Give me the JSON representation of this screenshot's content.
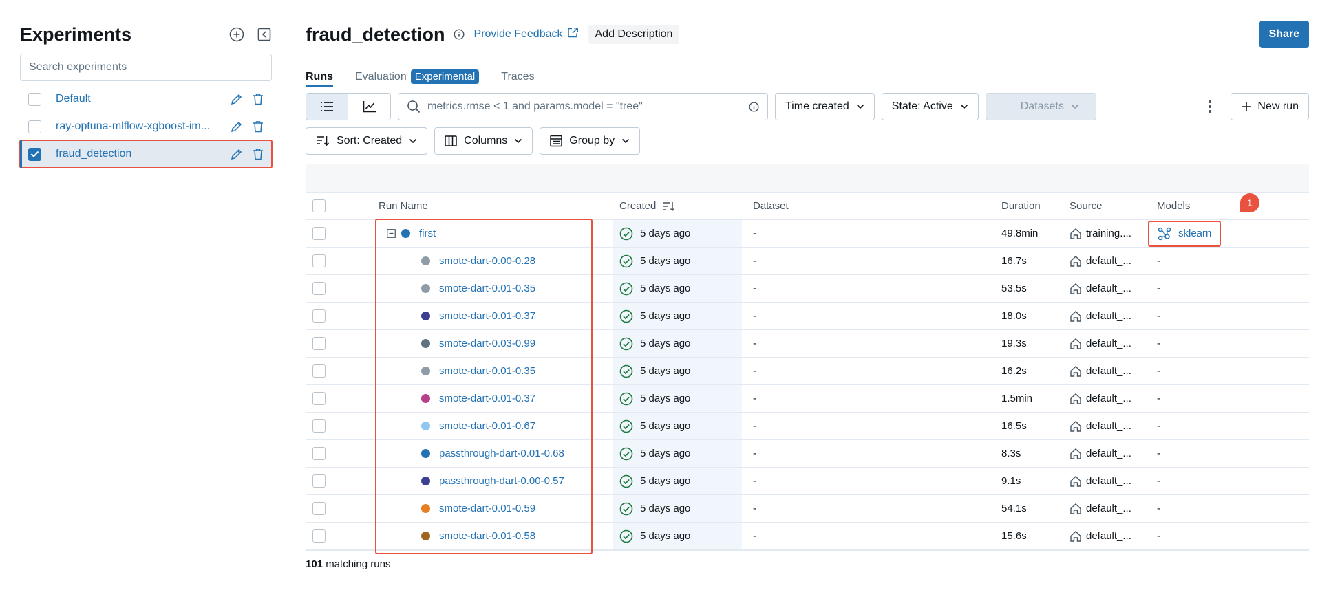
{
  "sidebar": {
    "title": "Experiments",
    "search_placeholder": "Search experiments",
    "items": [
      {
        "name": "Default",
        "checked": false
      },
      {
        "name": "ray-optuna-mlflow-xgboost-im...",
        "checked": false
      },
      {
        "name": "fraud_detection",
        "checked": true
      }
    ]
  },
  "header": {
    "title": "fraud_detection",
    "feedback_label": "Provide Feedback",
    "add_description_label": "Add Description",
    "share_label": "Share"
  },
  "tabs": {
    "runs": "Runs",
    "evaluation": "Evaluation",
    "evaluation_badge": "Experimental",
    "traces": "Traces"
  },
  "toolbar": {
    "search_value": "metrics.rmse < 1 and params.model = \"tree\"",
    "time_created": "Time created",
    "state": "State: Active",
    "datasets": "Datasets",
    "new_run": "New run",
    "sort": "Sort: Created",
    "columns": "Columns",
    "group_by": "Group by"
  },
  "table": {
    "headers": {
      "run_name": "Run Name",
      "created": "Created",
      "dataset": "Dataset",
      "duration": "Duration",
      "source": "Source",
      "models": "Models"
    },
    "rows": [
      {
        "name": "first",
        "color": "#2272b4",
        "created": "5 days ago",
        "dataset": "-",
        "duration": "49.8min",
        "source": "training....",
        "model": "sklearn",
        "parent": true
      },
      {
        "name": "smote-dart-0.00-0.28",
        "color": "#8f9ca8",
        "created": "5 days ago",
        "dataset": "-",
        "duration": "16.7s",
        "source": "default_...",
        "model": "-"
      },
      {
        "name": "smote-dart-0.01-0.35",
        "color": "#8f9ca8",
        "created": "5 days ago",
        "dataset": "-",
        "duration": "53.5s",
        "source": "default_...",
        "model": "-"
      },
      {
        "name": "smote-dart-0.01-0.37",
        "color": "#3c3f8f",
        "created": "5 days ago",
        "dataset": "-",
        "duration": "18.0s",
        "source": "default_...",
        "model": "-"
      },
      {
        "name": "smote-dart-0.03-0.99",
        "color": "#5f7281",
        "created": "5 days ago",
        "dataset": "-",
        "duration": "19.3s",
        "source": "default_...",
        "model": "-"
      },
      {
        "name": "smote-dart-0.01-0.35",
        "color": "#8f9ca8",
        "created": "5 days ago",
        "dataset": "-",
        "duration": "16.2s",
        "source": "default_...",
        "model": "-"
      },
      {
        "name": "smote-dart-0.01-0.37",
        "color": "#b83f8c",
        "created": "5 days ago",
        "dataset": "-",
        "duration": "1.5min",
        "source": "default_...",
        "model": "-"
      },
      {
        "name": "smote-dart-0.01-0.67",
        "color": "#8fc7f0",
        "created": "5 days ago",
        "dataset": "-",
        "duration": "16.5s",
        "source": "default_...",
        "model": "-"
      },
      {
        "name": "passthrough-dart-0.01-0.68",
        "color": "#2272b4",
        "created": "5 days ago",
        "dataset": "-",
        "duration": "8.3s",
        "source": "default_...",
        "model": "-"
      },
      {
        "name": "passthrough-dart-0.00-0.57",
        "color": "#3c3f8f",
        "created": "5 days ago",
        "dataset": "-",
        "duration": "9.1s",
        "source": "default_...",
        "model": "-"
      },
      {
        "name": "smote-dart-0.01-0.59",
        "color": "#e67e22",
        "created": "5 days ago",
        "dataset": "-",
        "duration": "54.1s",
        "source": "default_...",
        "model": "-"
      },
      {
        "name": "smote-dart-0.01-0.58",
        "color": "#a0661f",
        "created": "5 days ago",
        "dataset": "-",
        "duration": "15.6s",
        "source": "default_...",
        "model": "-"
      }
    ]
  },
  "notification_count": "1",
  "footer": {
    "count": "101",
    "label": "matching runs"
  },
  "colors": {
    "accent": "#2272b4",
    "highlight": "#e8523f",
    "success": "#1f7a3f"
  }
}
